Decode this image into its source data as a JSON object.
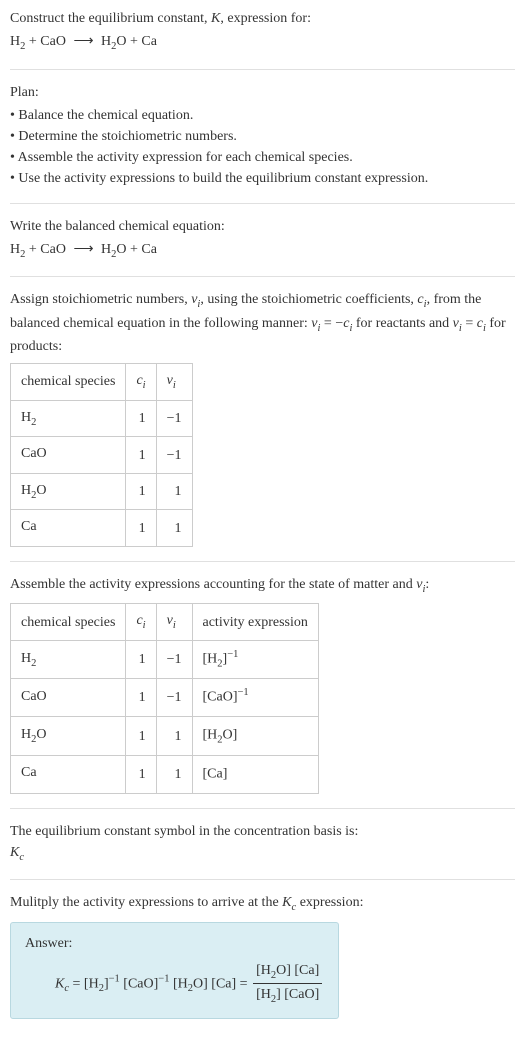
{
  "intro": {
    "line1_a": "Construct the equilibrium constant, ",
    "line1_b": ", expression for:",
    "eq_h2": "H",
    "eq_2": "2",
    "eq_plus": " + CaO ",
    "eq_arrow": "⟶",
    "eq_h2o_a": " H",
    "eq_h2o_b": "O + Ca"
  },
  "plan": {
    "title": "Plan:",
    "b1": "• Balance the chemical equation.",
    "b2": "• Determine the stoichiometric numbers.",
    "b3": "• Assemble the activity expression for each chemical species.",
    "b4": "• Use the activity expressions to build the equilibrium constant expression."
  },
  "balanced": {
    "line1": "Write the balanced chemical equation:"
  },
  "stoich": {
    "p1a": "Assign stoichiometric numbers, ",
    "p1b": ", using the stoichiometric coefficients, ",
    "p1c": ", from the balanced chemical equation in the following manner: ",
    "p1d": " for reactants and ",
    "p1e": " for products:",
    "headers": {
      "species": "chemical species",
      "ci": "c",
      "vi": "ν",
      "sub_i": "i"
    },
    "rows": [
      {
        "species_a": "H",
        "species_sub": "2",
        "species_b": "",
        "ci": "1",
        "vi": "−1"
      },
      {
        "species_a": "CaO",
        "species_sub": "",
        "species_b": "",
        "ci": "1",
        "vi": "−1"
      },
      {
        "species_a": "H",
        "species_sub": "2",
        "species_b": "O",
        "ci": "1",
        "vi": "1"
      },
      {
        "species_a": "Ca",
        "species_sub": "",
        "species_b": "",
        "ci": "1",
        "vi": "1"
      }
    ]
  },
  "activity": {
    "intro_a": "Assemble the activity expressions accounting for the state of matter and ",
    "intro_b": ":",
    "headers": {
      "activity": "activity expression"
    },
    "rows": [
      {
        "expr_a": "[H",
        "expr_sub": "2",
        "expr_b": "]",
        "expr_sup": "−1"
      },
      {
        "expr_a": "[CaO]",
        "expr_sub": "",
        "expr_b": "",
        "expr_sup": "−1"
      },
      {
        "expr_a": "[H",
        "expr_sub": "2",
        "expr_b": "O]",
        "expr_sup": ""
      },
      {
        "expr_a": "[Ca]",
        "expr_sub": "",
        "expr_b": "",
        "expr_sup": ""
      }
    ]
  },
  "kc_symbol": {
    "line1": "The equilibrium constant symbol in the concentration basis is:",
    "K": "K",
    "c": "c"
  },
  "multiply": {
    "line_a": "Mulitply the activity expressions to arrive at the ",
    "line_b": " expression:"
  },
  "answer": {
    "label": "Answer:",
    "K": "K",
    "c": "c",
    "eq": " = ",
    "t1a": "[H",
    "t1sub": "2",
    "t1b": "]",
    "t1sup": "−1",
    "t2": " [CaO]",
    "t2sup": "−1",
    "t3a": " [H",
    "t3sub": "2",
    "t3b": "O]",
    "t4": " [Ca] = ",
    "num_a": "[H",
    "num_sub": "2",
    "num_b": "O] [Ca]",
    "den_a": "[H",
    "den_sub": "2",
    "den_b": "] [CaO]"
  },
  "sym": {
    "K": "K",
    "nu": "ν",
    "c": "c",
    "i": "i",
    "minus": "−",
    "eq": " = "
  }
}
